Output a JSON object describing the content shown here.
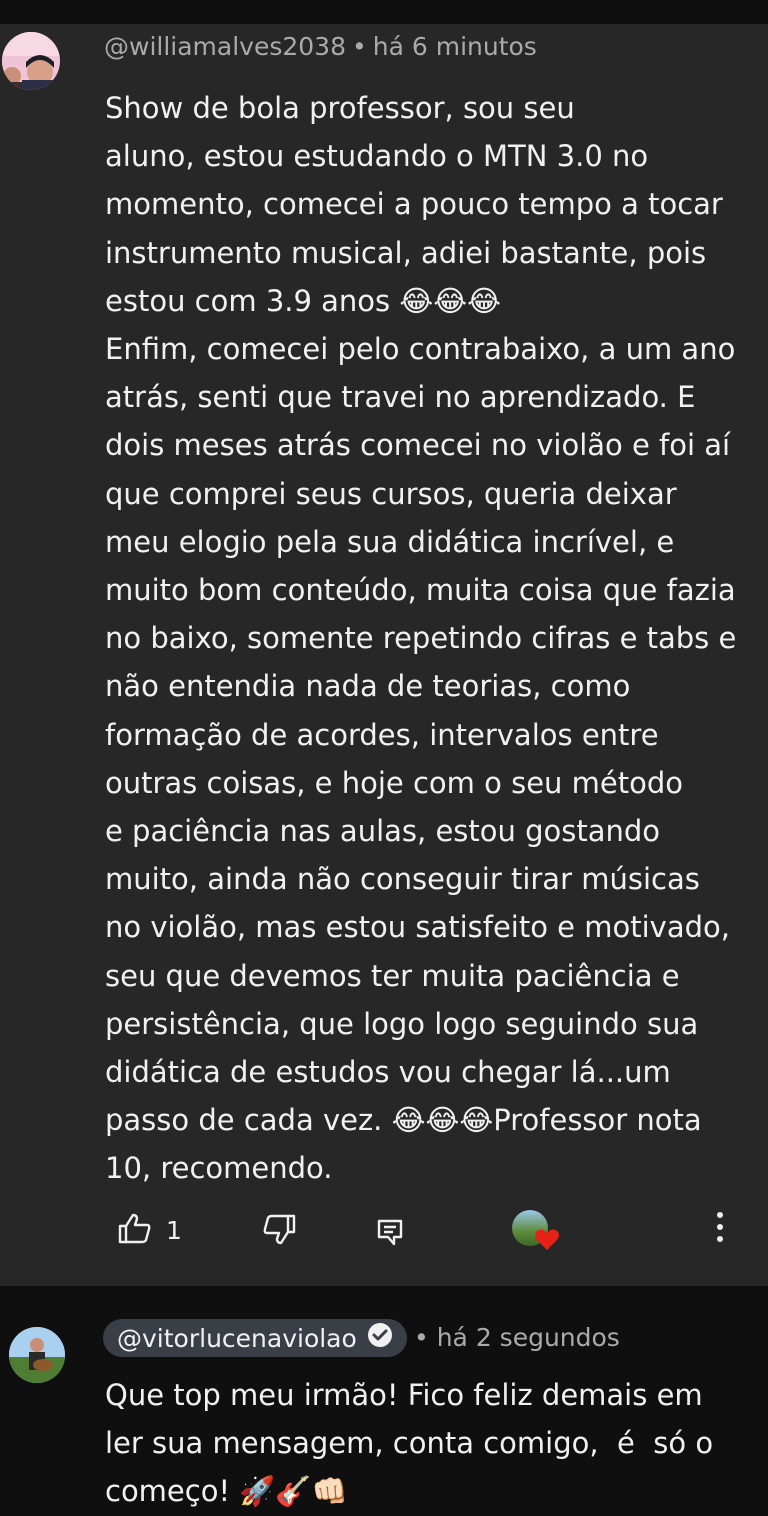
{
  "comment1": {
    "handle": "@williamalves2038",
    "time": "há 6 minutos",
    "separator": "•",
    "text": "Show de bola professor, sou seu\naluno, estou estudando o MTN 3.0 no momento, comecei a pouco tempo a tocar instrumento musical, adiei bastante, pois estou com 3.9 anos 😂😂😂\nEnfim, comecei pelo contrabaixo, a um ano atrás, senti que travei no aprendizado. E dois meses atrás comecei no violão e foi aí que comprei seus cursos, queria deixar meu elogio pela sua didática incrível, e muito bom conteúdo, muita coisa que fazia no baixo, somente repetindo cifras e tabs e não entendia nada de teorias, como formação de acordes, intervalos entre outras coisas, e hoje com o seu método\ne paciência nas aulas, estou gostando muito, ainda não conseguir tirar músicas no violão, mas estou satisfeito e motivado, seu que devemos ter muita paciência e persistência, que logo logo seguindo sua didática de estudos vou chegar lá...um passo de cada vez. 😂😂😂Professor nota 10, recomendo.",
    "like_count": "1",
    "icons": [
      "like-icon",
      "dislike-icon",
      "reply-icon",
      "creator-heart-icon",
      "more-icon"
    ]
  },
  "comment2": {
    "handle": "@vitorlucenaviolao",
    "time": "há 2 segundos",
    "separator": "•",
    "text": "Que top meu irmão! Fico feliz demais em ler sua mensagem, conta comigo,  é  só o começo! 🚀🎸👊🏻",
    "icons": [
      "verified-check-icon"
    ]
  },
  "colors": {
    "highlight_bg": "#272727",
    "page_bg": "#0f0f0f",
    "chip_bg": "#3a3f47",
    "heart": "#e62117",
    "meta_text": "#aaaaaa"
  }
}
